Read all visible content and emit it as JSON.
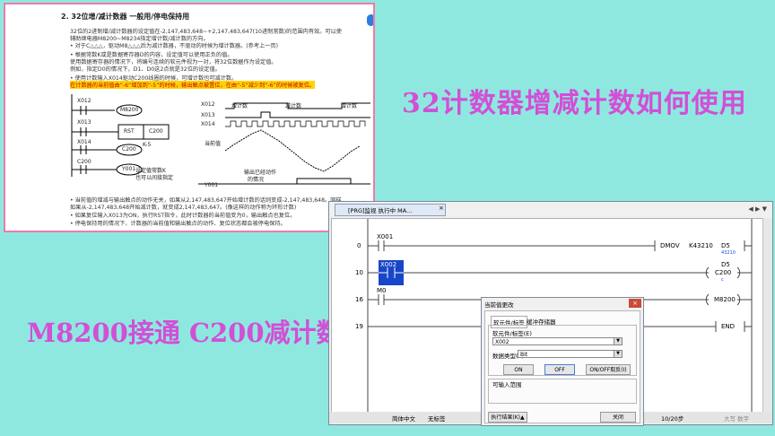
{
  "doc": {
    "heading": "2. 32位增/减计数器  一般用/停电保持用",
    "lines": [
      "32位的2进制增/减计数器的设定值在-2,147,483,648~+2,147,483,647(10进制常数)的范围内有效。可以使",
      "辅助继电器M8200~M8234指定增计数/减计数的方向。",
      "• 对于C△△△，驱动M8△△△后为减计数器，不驱动的时候为增计数器。(参考上一页)",
      "• 根据常数K或是数据寄存器D的内容，设定值可以使用正负的值。",
      "  使用数据寄存器的情况下，将编号连续的软元件视为一对，将32位数据作为设定值。",
      "  例如，指定D0的情况下，D1、D0这2点就是32位的设定值。",
      "• 使用计数输入X014驱动C200线圈的时候，可增计数也可减计数。",
      "  在计数器的当前值由“-6”增加到“-5”的时候，输出触点被置位，在由“-5”减少到“-6”的时候被复位。",
      "• 当前值的增减与输出触点的动作无关，如果从2,147,483,647开始增计数的话则变成-2,147,483,648。同样",
      "  如果从-2,147,483,648开始减计数，就变成2,147,483,647。(像这样的动作称为环形计数)",
      "• 如果复位输入X013为ON，执行RST指令，此时计数器的当前值变为0，输出触点也复位。",
      "• 停电保持用的情况下，计数器的当前值和输出触点的动作、复位状态都会被停电保持。"
    ],
    "ladder_labels": {
      "x012": "X012",
      "m8200": "M8200",
      "x013": "X013",
      "rst": "RST",
      "c200": "C200",
      "x014": "X014",
      "c200b": "C200",
      "k5": "K-5",
      "c200c": "C200",
      "y001": "Y001",
      "note1": "设定值常数K",
      "note2": "也可以间接指定"
    },
    "timing_labels": {
      "x012": "X012",
      "inc": "增计数",
      "dec": "减计数",
      "inc2": "增计数",
      "x013": "X013",
      "x014": "X014",
      "cur": "当前值",
      "note1": "输出已经动作",
      "note2": "的情况",
      "y001": "Y001"
    }
  },
  "title_right": "32计数器增减计数如何使用",
  "title_left": "M8200接通 C200减计数",
  "editor": {
    "tab": "[PRG]监视 执行中 MA...",
    "tab_close": "×",
    "rungs": [
      {
        "step": "0",
        "contact": "X001",
        "instr": "DMOV",
        "arg1": "K43210",
        "arg2": "D5",
        "sub": "43210"
      },
      {
        "step": "10",
        "contact": "X002",
        "coil": "C200",
        "arg2": "D5",
        "sub": "c"
      },
      {
        "step": "16",
        "contact": "M0",
        "coil": "M8200"
      },
      {
        "step": "19",
        "instr": "END"
      }
    ],
    "status": {
      "lang": "简体中文",
      "mode": "无标签",
      "steps": "10/20步",
      "right": "大写 数字"
    }
  },
  "dialog": {
    "title": "当前值更改",
    "close": "×",
    "tab1": "软元件/标签",
    "tab2": "缓冲存储器",
    "dev_label": "软元件/标签(E)",
    "dev_value": "X002",
    "type_label": "数据类型(T)",
    "type_value": "Bit",
    "on": "ON",
    "off": "OFF",
    "onoff": "ON/OFF取反(I)",
    "range": "可输入范围",
    "result": "执行结果(K)▲",
    "close_btn": "关闭"
  }
}
